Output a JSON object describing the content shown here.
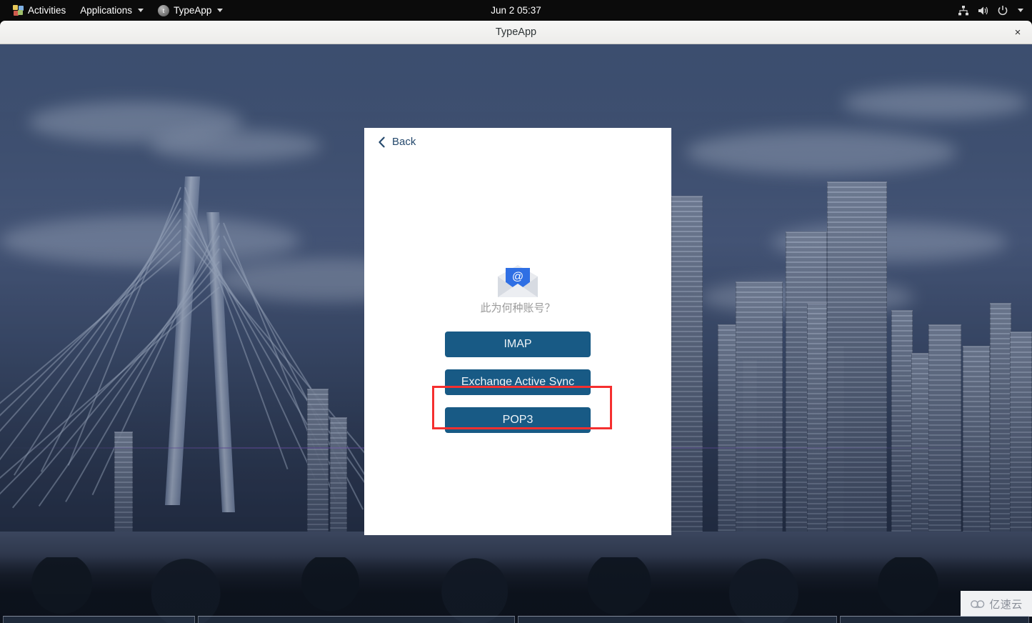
{
  "topbar": {
    "activities_label": "Activities",
    "activities_icon": "activities-grid-icon",
    "applications_label": "Applications",
    "app_menu_label": "TypeApp",
    "app_menu_icon": "typeapp-circle-icon",
    "app_menu_initial": "t",
    "clock": "Jun 2  05:37",
    "status_icons": [
      "network-icon",
      "volume-icon",
      "power-icon",
      "chevron-down-icon"
    ]
  },
  "window": {
    "title": "TypeApp",
    "close_label": "×"
  },
  "card": {
    "back_label": "Back",
    "back_icon": "chevron-left-icon",
    "hero_icon": "open-envelope-at-icon",
    "prompt": "此为何种账号？",
    "choices": [
      {
        "label": "IMAP",
        "name": "imap-button"
      },
      {
        "label": "Exchange Active Sync",
        "name": "exchange-active-sync-button"
      },
      {
        "label": "POP3",
        "name": "pop3-button"
      }
    ]
  },
  "annotation": {
    "target": "Exchange Active Sync",
    "color": "#f52f2f"
  },
  "watermark": {
    "text": "亿速云",
    "icon": "cloud-icon"
  },
  "colors": {
    "button_blue": "#185a85",
    "back_link_blue": "#24486c",
    "prompt_gray": "#9a9a9a",
    "titlebar_gray": "#f1f0ee",
    "topbar_black": "#0b0b0b",
    "card_white": "#ffffff",
    "annotation_red": "#f52f2f",
    "wallpaper_blue": "#4e6385"
  }
}
